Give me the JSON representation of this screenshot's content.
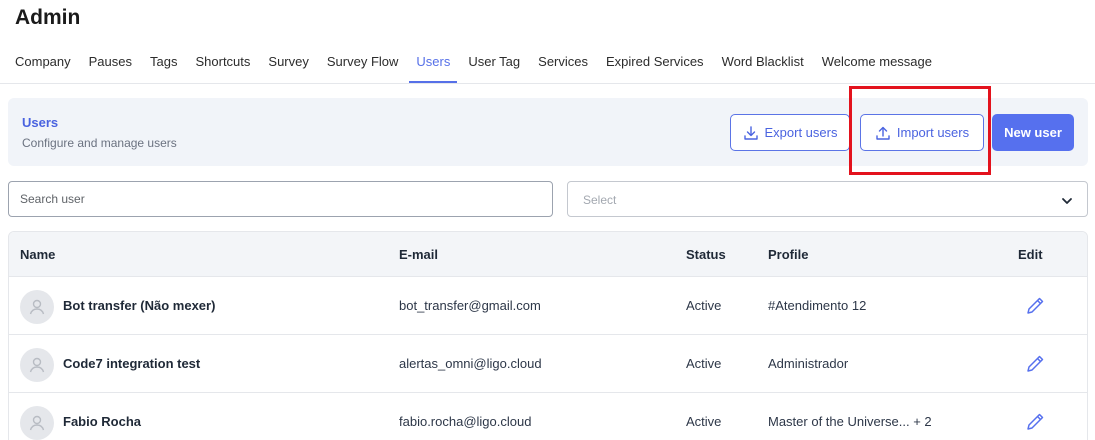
{
  "page": {
    "title": "Admin"
  },
  "tabs": [
    {
      "label": "Company"
    },
    {
      "label": "Pauses"
    },
    {
      "label": "Tags"
    },
    {
      "label": "Shortcuts"
    },
    {
      "label": "Survey"
    },
    {
      "label": "Survey Flow"
    },
    {
      "label": "Users",
      "active": true
    },
    {
      "label": "User Tag"
    },
    {
      "label": "Services"
    },
    {
      "label": "Expired Services"
    },
    {
      "label": "Word Blacklist"
    },
    {
      "label": "Welcome message"
    }
  ],
  "users_panel": {
    "title": "Users",
    "subtitle": "Configure and manage users",
    "export_label": "Export users",
    "import_label": "Import users",
    "new_label": "New user"
  },
  "filters": {
    "search_placeholder": "Search user",
    "select_placeholder": "Select"
  },
  "table": {
    "headers": {
      "name": "Name",
      "email": "E-mail",
      "status": "Status",
      "profile": "Profile",
      "edit": "Edit"
    },
    "rows": [
      {
        "name": "Bot transfer (Não mexer)",
        "email": "bot_transfer@gmail.com",
        "status": "Active",
        "profile": "#Atendimento 12"
      },
      {
        "name": "Code7 integration test",
        "email": "alertas_omni@ligo.cloud",
        "status": "Active",
        "profile": "Administrador"
      },
      {
        "name": "Fabio Rocha",
        "email": "fabio.rocha@ligo.cloud",
        "status": "Active",
        "profile": "Master of the Universe... + 2"
      }
    ]
  },
  "colors": {
    "accent": "#5670ee",
    "highlight": "#e3121d",
    "panel_bg": "#f1f4f9"
  },
  "icons": {
    "export": "download-icon",
    "import": "upload-icon",
    "select": "chevron-down-icon",
    "avatar": "user-icon",
    "edit": "pencil-icon"
  }
}
